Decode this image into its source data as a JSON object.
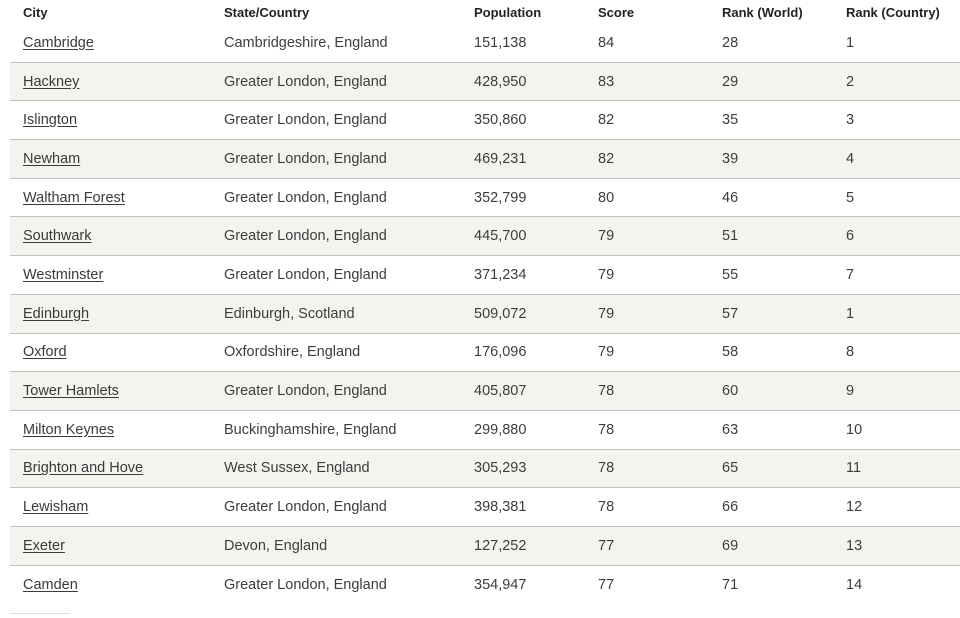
{
  "table": {
    "headers": [
      "City",
      "State/Country",
      "Population",
      "Score",
      "Rank (World)",
      "Rank (Country)"
    ],
    "rows": [
      {
        "city": "Cambridge",
        "region": "Cambridgeshire, England",
        "population": "151,138",
        "score": "84",
        "rank_world": "28",
        "rank_country": "1"
      },
      {
        "city": "Hackney",
        "region": "Greater London, England",
        "population": "428,950",
        "score": "83",
        "rank_world": "29",
        "rank_country": "2"
      },
      {
        "city": "Islington",
        "region": "Greater London, England",
        "population": "350,860",
        "score": "82",
        "rank_world": "35",
        "rank_country": "3"
      },
      {
        "city": "Newham",
        "region": "Greater London, England",
        "population": "469,231",
        "score": "82",
        "rank_world": "39",
        "rank_country": "4"
      },
      {
        "city": "Waltham Forest",
        "region": "Greater London, England",
        "population": "352,799",
        "score": "80",
        "rank_world": "46",
        "rank_country": "5"
      },
      {
        "city": "Southwark",
        "region": "Greater London, England",
        "population": "445,700",
        "score": "79",
        "rank_world": "51",
        "rank_country": "6"
      },
      {
        "city": "Westminster",
        "region": "Greater London, England",
        "population": "371,234",
        "score": "79",
        "rank_world": "55",
        "rank_country": "7"
      },
      {
        "city": "Edinburgh",
        "region": "Edinburgh, Scotland",
        "population": "509,072",
        "score": "79",
        "rank_world": "57",
        "rank_country": "1"
      },
      {
        "city": "Oxford",
        "region": "Oxfordshire, England",
        "population": "176,096",
        "score": "79",
        "rank_world": "58",
        "rank_country": "8"
      },
      {
        "city": "Tower Hamlets",
        "region": "Greater London, England",
        "population": "405,807",
        "score": "78",
        "rank_world": "60",
        "rank_country": "9"
      },
      {
        "city": "Milton Keynes",
        "region": "Buckinghamshire, England",
        "population": "299,880",
        "score": "78",
        "rank_world": "63",
        "rank_country": "10"
      },
      {
        "city": "Brighton and Hove",
        "region": "West Sussex, England",
        "population": "305,293",
        "score": "78",
        "rank_world": "65",
        "rank_country": "11"
      },
      {
        "city": "Lewisham",
        "region": "Greater London, England",
        "population": "398,381",
        "score": "78",
        "rank_world": "66",
        "rank_country": "12"
      },
      {
        "city": "Exeter",
        "region": "Devon, England",
        "population": "127,252",
        "score": "77",
        "rank_world": "69",
        "rank_country": "13"
      },
      {
        "city": "Camden",
        "region": "Greater London, England",
        "population": "354,947",
        "score": "77",
        "rank_world": "71",
        "rank_country": "14"
      }
    ]
  },
  "colors": {
    "alt_row_bg": "#f4f3ef",
    "row_border": "#c4c2bd",
    "text": "#3d3d3d"
  }
}
